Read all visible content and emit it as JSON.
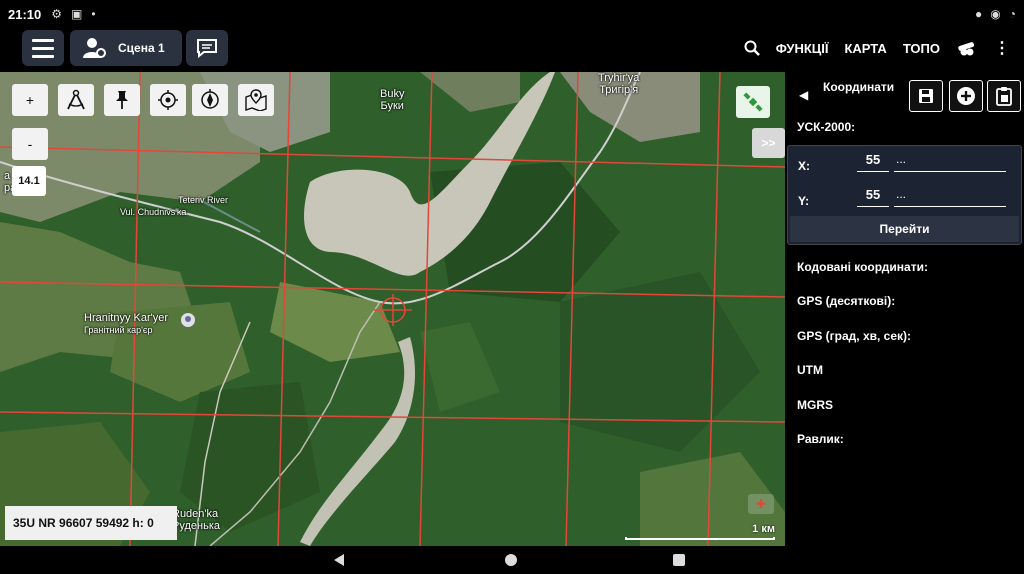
{
  "status": {
    "time": "21:10"
  },
  "appbar": {
    "scene_label": "Сцена 1",
    "functions": "ФУНКЦІЇ",
    "map": "КАРТА",
    "topo": "ТОПО"
  },
  "map": {
    "labels": {
      "buky_latin": "Buky",
      "buky_cyr": "Буки",
      "tryhir_latin": "Tryhir'ya",
      "tryhir_cyr": "Тригір'я",
      "teteriv": "Teteriv River",
      "chudniv": "Vul. Chudnivs'ka",
      "quarry_latin": "Hranitnyy Kar'yer",
      "quarry_cyr": "Гранітний кар'єр",
      "rudenka_latin": "Ruden'ka",
      "rudenka_cyr": "Руденька",
      "village_left_1": "а",
      "village_left_2": "ра"
    },
    "zoom_badge": "14.1",
    "zoom_in": "+",
    "zoom_out": "-",
    "collapse_label": ">>",
    "coordinate_readout": "35U NR 96607 59492 h: 0",
    "scale_label": "1 км"
  },
  "panel": {
    "title": "Координати",
    "system_label": "УСК-2000:",
    "x_label": "X:",
    "x_value": "55",
    "x_ext": "...",
    "y_label": "Y:",
    "y_value": "55",
    "y_ext": "...",
    "go_button": "Перейти",
    "encoded": "Кодовані координати:",
    "gps_dec": "GPS (десяткові):",
    "gps_dms": "GPS (град, хв, сек):",
    "utm": "UTM",
    "mgrs": "MGRS",
    "ravlyk": "Равлик:"
  },
  "colors": {
    "grid": "#e3473a",
    "panel_bg": "#000000",
    "button_bg": "#2a3240",
    "coord_box_bg": "#1c2434",
    "gps_icon": "#2e9a3c"
  }
}
